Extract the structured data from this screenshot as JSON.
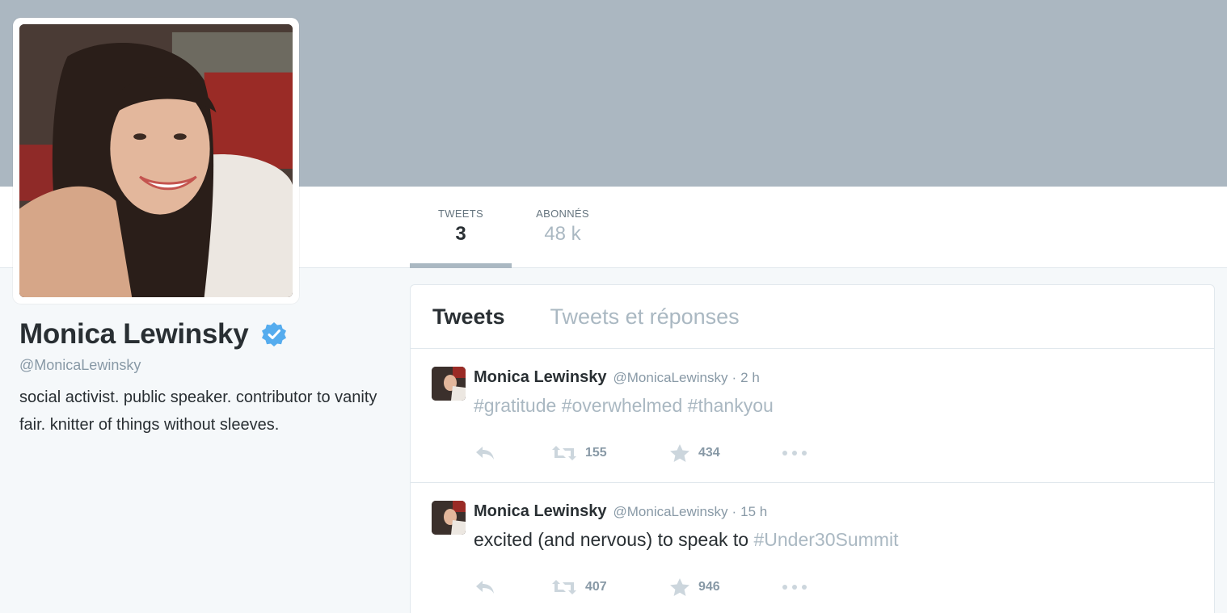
{
  "profile": {
    "name": "Monica Lewinsky",
    "handle": "@MonicaLewinsky",
    "bio": "social activist. public speaker. contributor to vanity fair. knitter of things without sleeves.",
    "verified": true
  },
  "stats": [
    {
      "label": "TWEETS",
      "value": "3",
      "active": true
    },
    {
      "label": "ABONNÉS",
      "value": "48 k",
      "active": false
    }
  ],
  "stream_tabs": [
    {
      "label": "Tweets",
      "active": true
    },
    {
      "label": "Tweets et réponses",
      "active": false
    }
  ],
  "tweets": [
    {
      "author": "Monica Lewinsky",
      "handle": "@MonicaLewinsky",
      "time": "2 h",
      "text_plain": "",
      "hashtags": "#gratitude #overwhelmed #thankyou",
      "retweets": "155",
      "favorites": "434"
    },
    {
      "author": "Monica Lewinsky",
      "handle": "@MonicaLewinsky",
      "time": "15 h",
      "text_plain": "excited (and nervous) to speak to ",
      "hashtags": "#Under30Summit",
      "retweets": "407",
      "favorites": "946"
    }
  ],
  "colors": {
    "banner": "#abb7c1",
    "verified_blue": "#55acee",
    "muted": "#8899a6",
    "hashtag": "#aab8c2"
  },
  "icons": [
    "verified-icon",
    "reply-icon",
    "retweet-icon",
    "favorite-star-icon",
    "more-icon"
  ]
}
